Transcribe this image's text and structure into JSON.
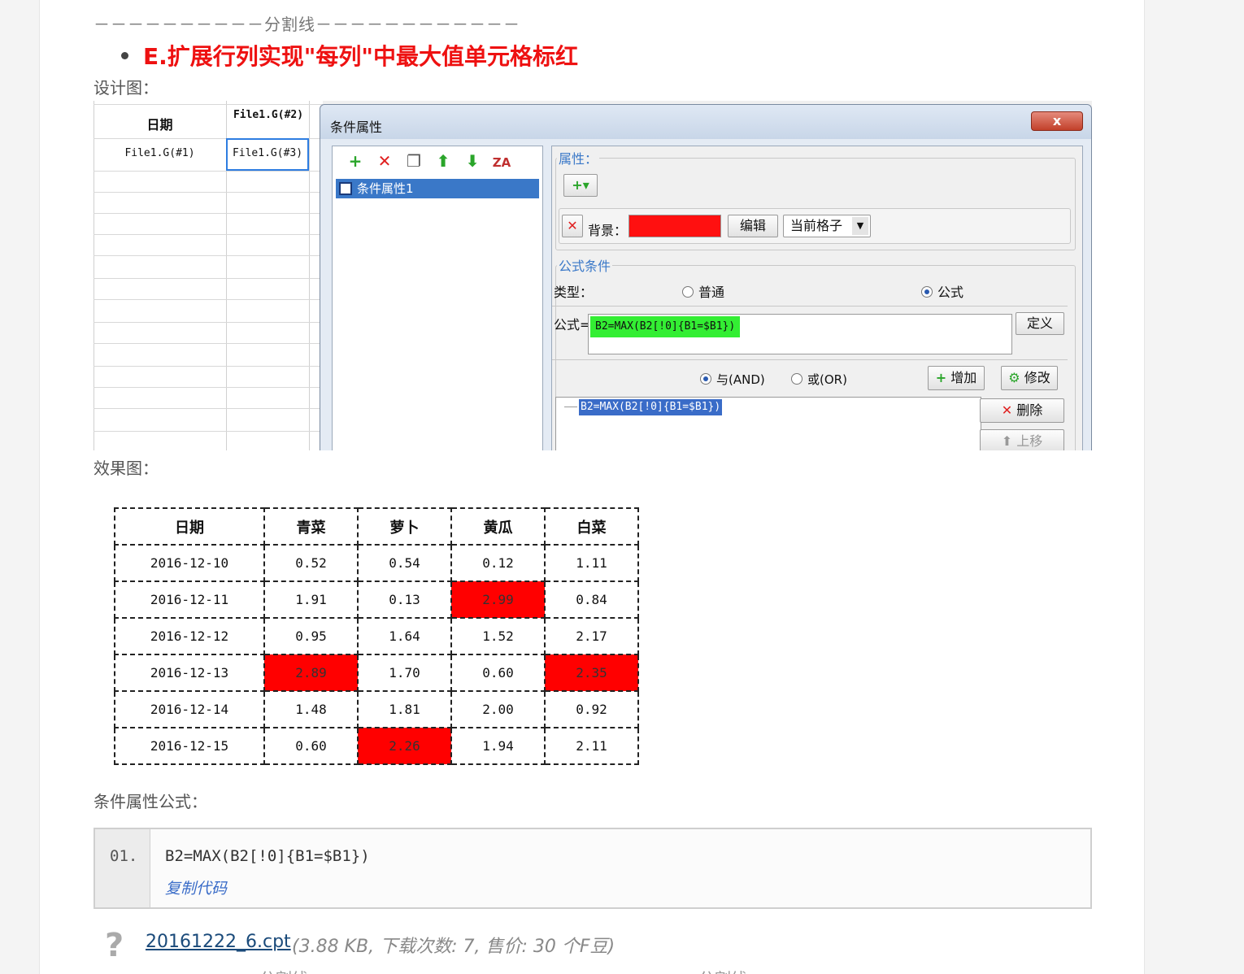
{
  "article": {
    "divider_top": "－－－－－－－－－－分割线－－－－－－－－－－－－",
    "heading": "E.扩展行列实现\"每列\"中最大值单元格标红",
    "design_label": "设计图：",
    "effect_label": "效果图：",
    "formula_label": "条件属性公式："
  },
  "design": {
    "sheet": {
      "col1_header": "日期",
      "col2_header": "File1.G(#2)",
      "col1_cell": "File1.G(#1)",
      "col2_cell": "File1.G(#3)"
    },
    "dialog": {
      "title": "条件属性",
      "close_label": "x",
      "toolbar_icons": [
        "plus-icon",
        "delete-icon",
        "copy-icon",
        "up-arrow-icon",
        "down-arrow-icon",
        "sort-icon"
      ],
      "tree_item": "条件属性1",
      "attr_group": "属性：",
      "add_dropdown": "+▾",
      "bg_label": "背景：",
      "bg_color": "#ff1010",
      "edit_button": "编辑",
      "scope_select": "当前格子",
      "formula_group": "公式条件",
      "type_label": "类型：",
      "type_normal": "普通",
      "type_formula": "公式",
      "formula_label": "公式=",
      "formula_value": "B2=MAX(B2[!0]{B1=$B1})",
      "define_button": "定义",
      "and_label": "与(AND)",
      "or_label": "或(OR)",
      "add_button": "增加",
      "modify_button": "修改",
      "list_item": "B2=MAX(B2[!0]{B1=$B1})",
      "delete_button": "删除",
      "move_up_button": "上移"
    }
  },
  "effect_table": {
    "headers": [
      "日期",
      "青菜",
      "萝卜",
      "黄瓜",
      "白菜"
    ],
    "rows": [
      [
        "2016-12-10",
        "0.52",
        "0.54",
        "0.12",
        "1.11"
      ],
      [
        "2016-12-11",
        "1.91",
        "0.13",
        "2.99",
        "0.84"
      ],
      [
        "2016-12-12",
        "0.95",
        "1.64",
        "1.52",
        "2.17"
      ],
      [
        "2016-12-13",
        "2.89",
        "1.70",
        "0.60",
        "2.35"
      ],
      [
        "2016-12-14",
        "1.48",
        "1.81",
        "2.00",
        "0.92"
      ],
      [
        "2016-12-15",
        "0.60",
        "2.26",
        "1.94",
        "2.11"
      ]
    ],
    "highlight_color": "#ff0000"
  },
  "code": {
    "line_no": "01.",
    "source": "B2=MAX(B2[!0]{B1=$B1})",
    "copy_label": "复制代码"
  },
  "attachment": {
    "icon": "unknown-file-icon",
    "name": "20161222_6.cpt",
    "meta": "(3.88 KB, 下载次数: 7, 售价: 30 个F豆)"
  },
  "divider_bottom": "分割线"
}
